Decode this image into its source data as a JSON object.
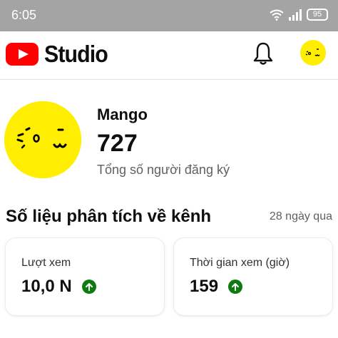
{
  "status_bar": {
    "time": "6:05",
    "battery": "95"
  },
  "header": {
    "logo_text": "Studio"
  },
  "channel": {
    "name": "Mango",
    "subscribers": "727",
    "subscribers_label": "Tổng số người đăng ký"
  },
  "analytics": {
    "title": "Số liệu phân tích về kênh",
    "range": "28 ngày qua",
    "cards": [
      {
        "label": "Lượt xem",
        "value": "10,0 N",
        "trend": "up"
      },
      {
        "label": "Thời gian xem (giờ)",
        "value": "159",
        "trend": "up"
      }
    ]
  },
  "colors": {
    "brand_red": "#ff0000",
    "avatar_yellow": "#ffee00",
    "trend_green": "#0f7a12",
    "status_bar_gray": "#a4a4a4"
  },
  "icons": [
    "wifi-icon",
    "signal-icon",
    "battery-icon",
    "youtube-logo-icon",
    "bell-icon",
    "avatar-icon",
    "arrow-up-icon"
  ]
}
